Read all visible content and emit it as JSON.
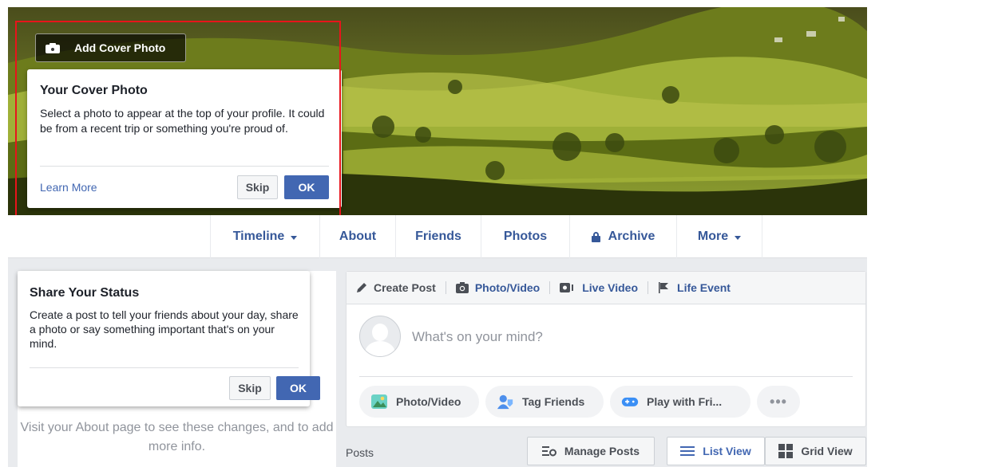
{
  "cover": {
    "add_cover_label": "Add Cover Photo"
  },
  "cover_popup": {
    "title": "Your Cover Photo",
    "body": "Select a photo to appear at the top of your profile. It could be from a recent trip or something you're proud of.",
    "learn_more": "Learn More",
    "skip": "Skip",
    "ok": "OK"
  },
  "nav": {
    "items": [
      {
        "label": "Timeline",
        "has_caret": true
      },
      {
        "label": "About"
      },
      {
        "label": "Friends"
      },
      {
        "label": "Photos"
      },
      {
        "label": "Archive",
        "icon": "lock-icon"
      },
      {
        "label": "More",
        "has_caret": true
      }
    ]
  },
  "status_popup": {
    "title": "Share Your Status",
    "body": "Create a post to tell your friends about your day, share a photo or say something important that's on your mind.",
    "skip": "Skip",
    "ok": "OK"
  },
  "about_hint": {
    "text": "Visit your About page to see these changes, and to add more info."
  },
  "composer": {
    "tabs": [
      {
        "label": "Create Post",
        "icon": "pencil-icon"
      },
      {
        "label": "Photo/Video",
        "icon": "camera-icon"
      },
      {
        "label": "Live Video",
        "icon": "live-video-icon"
      },
      {
        "label": "Life Event",
        "icon": "flag-icon"
      }
    ],
    "placeholder": "What's on your mind?",
    "actions": [
      {
        "label": "Photo/Video",
        "icon": "photo-icon"
      },
      {
        "label": "Tag Friends",
        "icon": "tag-friends-icon"
      },
      {
        "label": "Play with Fri...",
        "icon": "game-controller-icon"
      },
      {
        "label": "•••",
        "icon": "more-icon"
      }
    ]
  },
  "posts_bar": {
    "label": "Posts",
    "manage_posts": "Manage Posts",
    "list_view": "List View",
    "grid_view": "Grid View"
  },
  "colors": {
    "brand_blue": "#4267b2",
    "link_blue": "#365899",
    "highlight_red": "#e8141b",
    "background": "#e9ebee"
  }
}
